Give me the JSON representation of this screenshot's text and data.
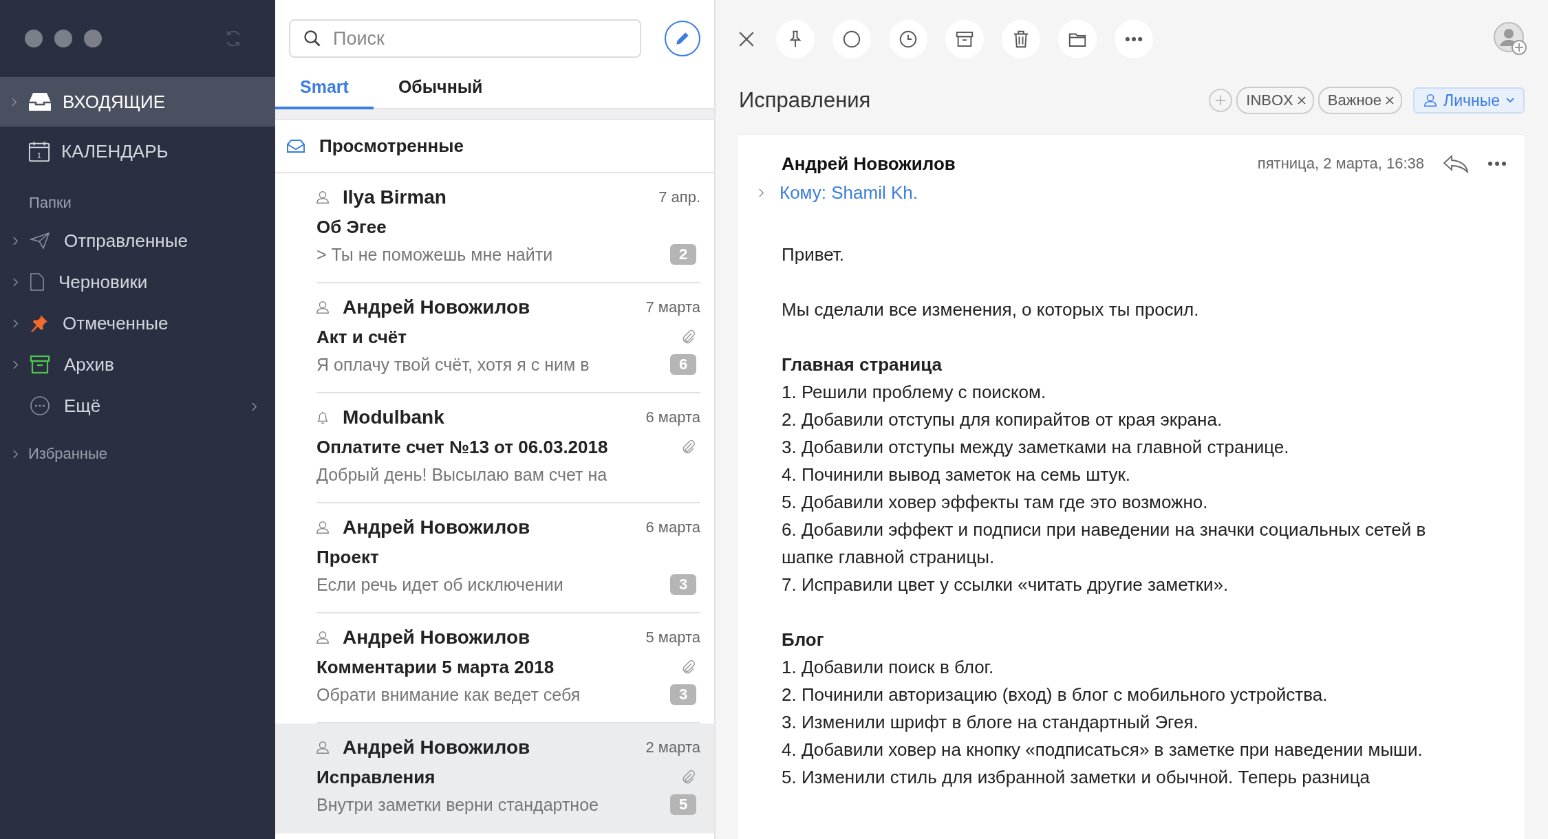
{
  "sidebar": {
    "main_items": [
      {
        "label": "ВХОДЯЩИЕ",
        "kind": "inbox",
        "selected": true
      },
      {
        "label": "КАЛЕНДАРЬ",
        "kind": "calendar",
        "icon_text": "1",
        "selected": false
      }
    ],
    "section_label": "Папки",
    "folders": [
      {
        "label": "Отправленные",
        "kind": "sent"
      },
      {
        "label": "Черновики",
        "kind": "draft"
      },
      {
        "label": "Отмеченные",
        "kind": "pin"
      },
      {
        "label": "Архив",
        "kind": "archive"
      },
      {
        "label": "Ещё",
        "kind": "more"
      }
    ],
    "favorites": "Избранные"
  },
  "list": {
    "search": {
      "placeholder": "Поиск"
    },
    "tabs": [
      {
        "label": "Smart",
        "selected": true
      },
      {
        "label": "Обычный",
        "selected": false
      }
    ],
    "group_header": "Просмотренные",
    "messages": [
      {
        "sender": "Ilya Birman",
        "kind": "person",
        "date": "7 апр.",
        "subject": "Об Эгее",
        "preview": "> Ты не поможешь мне найти",
        "attachment": false,
        "count": "2",
        "selected": false
      },
      {
        "sender": "Андрей Новожилов",
        "kind": "person",
        "date": "7 марта",
        "subject": "Акт и счёт",
        "preview": "Я оплачу твой счёт, хотя я с ним в",
        "attachment": true,
        "count": "6",
        "selected": false
      },
      {
        "sender": "Modulbank",
        "kind": "bell",
        "date": "6 марта",
        "subject": "Оплатите счет №13 от 06.03.2018",
        "preview": "Добрый день! Высылаю вам счет на",
        "attachment": true,
        "selected": false
      },
      {
        "sender": "Андрей Новожилов",
        "kind": "person",
        "date": "6 марта",
        "subject": "Проект",
        "preview": "Если речь идет об исключении",
        "attachment": false,
        "count": "3",
        "selected": false
      },
      {
        "sender": "Андрей Новожилов",
        "kind": "person",
        "date": "5 марта",
        "subject": "Комментарии 5 марта 2018",
        "preview": "Обрати внимание как ведет себя",
        "attachment": true,
        "count": "3",
        "selected": false
      },
      {
        "sender": "Андрей Новожилов",
        "kind": "person",
        "date": "2 марта",
        "subject": "Исправления",
        "preview": "Внутри заметки верни стандартное",
        "attachment": true,
        "count": "5",
        "selected": true
      }
    ]
  },
  "reader": {
    "title": "Исправления",
    "tags": [
      {
        "label": "INBOX"
      },
      {
        "label": "Важное"
      }
    ],
    "category": "Личные",
    "message": {
      "from": "Андрей Новожилов",
      "date": "пятница, 2 марта, 16:38",
      "to": "Кому: Shamil Kh.",
      "body": [
        {
          "lines": [
            "Привет."
          ]
        },
        {
          "lines": [
            "Мы сделали все изменения, о которых ты просил."
          ]
        },
        {
          "heading": "Главная страница",
          "lines": [
            "1. Решили проблему с поиском.",
            "2. Добавили отступы для копирайтов от края экрана.",
            "3. Добавили отступы между заметками на главной странице.",
            "4. Починили вывод заметок на семь штук.",
            "5. Добавили ховер эффекты там где это возможно.",
            "6. Добавили эффект и подписи при наведении на значки социальных сетей в шапке главной страницы.",
            "7. Исправили цвет у ссылки «читать другие заметки»."
          ]
        },
        {
          "heading": "Блог",
          "lines": [
            "1. Добавили поиск в блог.",
            "2. Починили авторизацию (вход) в блог с мобильного устройства.",
            "3. Изменили шрифт в блоге на стандартный Эгея.",
            "4. Добавили ховер на кнопку «подписаться» в заметке при наведении мыши.",
            "5. Изменили стиль для избранной заметки и обычной. Теперь разница"
          ]
        }
      ]
    }
  }
}
